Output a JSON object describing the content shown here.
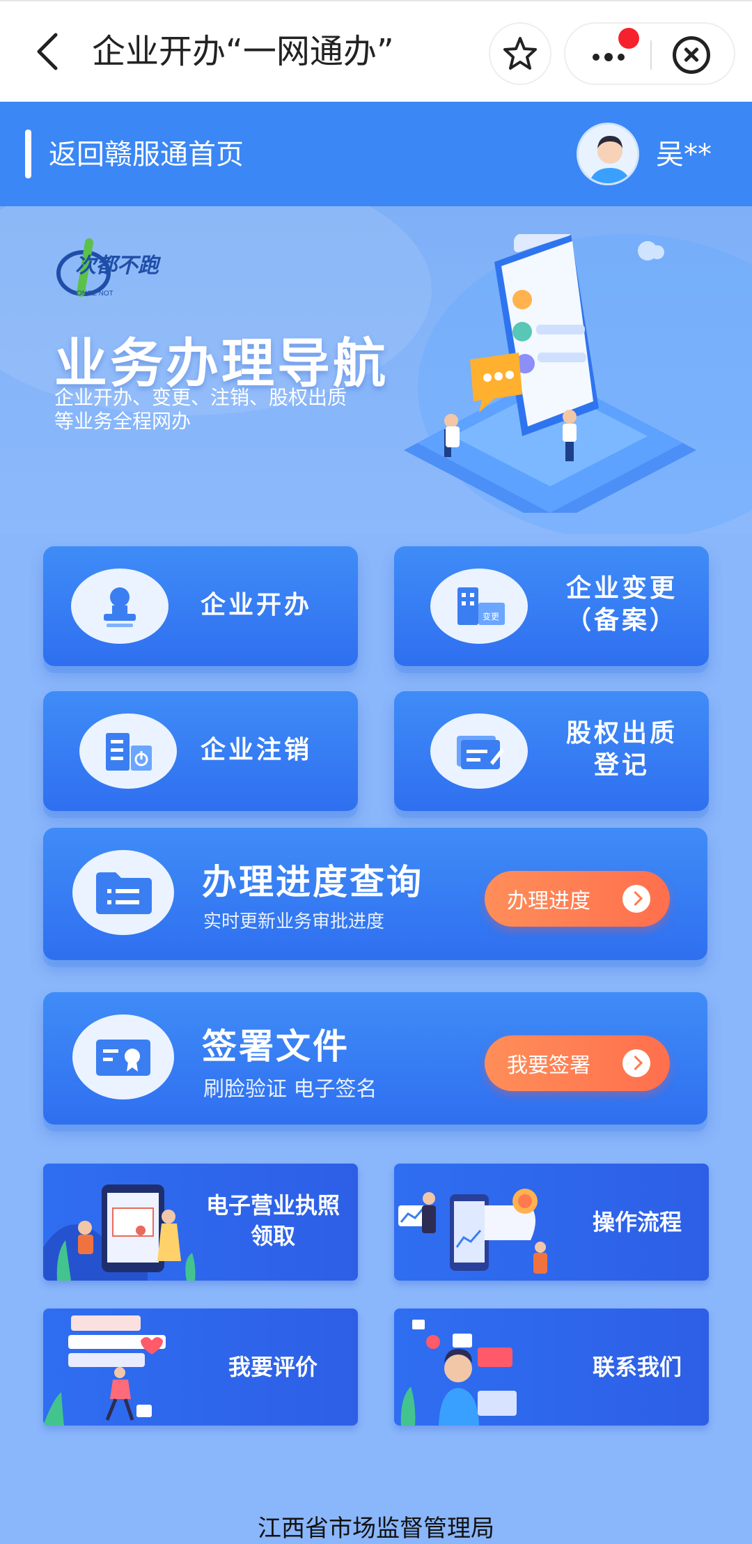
{
  "nav": {
    "title": "企业开办“一网通办”",
    "back_icon": "chevron-left-icon",
    "favorite_icon": "star-icon",
    "more_icon": "more-dots-icon",
    "close_icon": "close-circle-icon"
  },
  "header": {
    "home_link": "返回赣服通首页",
    "username": "吴**"
  },
  "hero": {
    "logo_text": "次都不跑",
    "title": "业务办理导航",
    "subtitle_line1": "企业开办、变更、注销、股权出质",
    "subtitle_line2": "等业务全程网办"
  },
  "services": [
    {
      "label": "企业开办",
      "icon": "stamp-icon"
    },
    {
      "label_line1": "企业变更",
      "label_line2": "（备案）",
      "icon": "building-change-icon",
      "badge": "变更"
    },
    {
      "label": "企业注销",
      "icon": "building-power-icon"
    },
    {
      "label_line1": "股权出质",
      "label_line2": "登记",
      "icon": "certificate-pen-icon"
    }
  ],
  "progress": {
    "title": "办理进度查询",
    "subtitle": "实时更新业务审批进度",
    "button": "办理进度",
    "icon": "folder-list-icon"
  },
  "sign": {
    "title": "签署文件",
    "subtitle": "刷脸验证 电子签名",
    "button": "我要签署",
    "icon": "certificate-seal-icon"
  },
  "banners": [
    {
      "line1": "电子营业执照",
      "line2": "领取"
    },
    {
      "line1": "操作流程"
    },
    {
      "line1": "我要评价"
    },
    {
      "line1": "联系我们"
    }
  ],
  "footer": "江西省市场监督管理局"
}
